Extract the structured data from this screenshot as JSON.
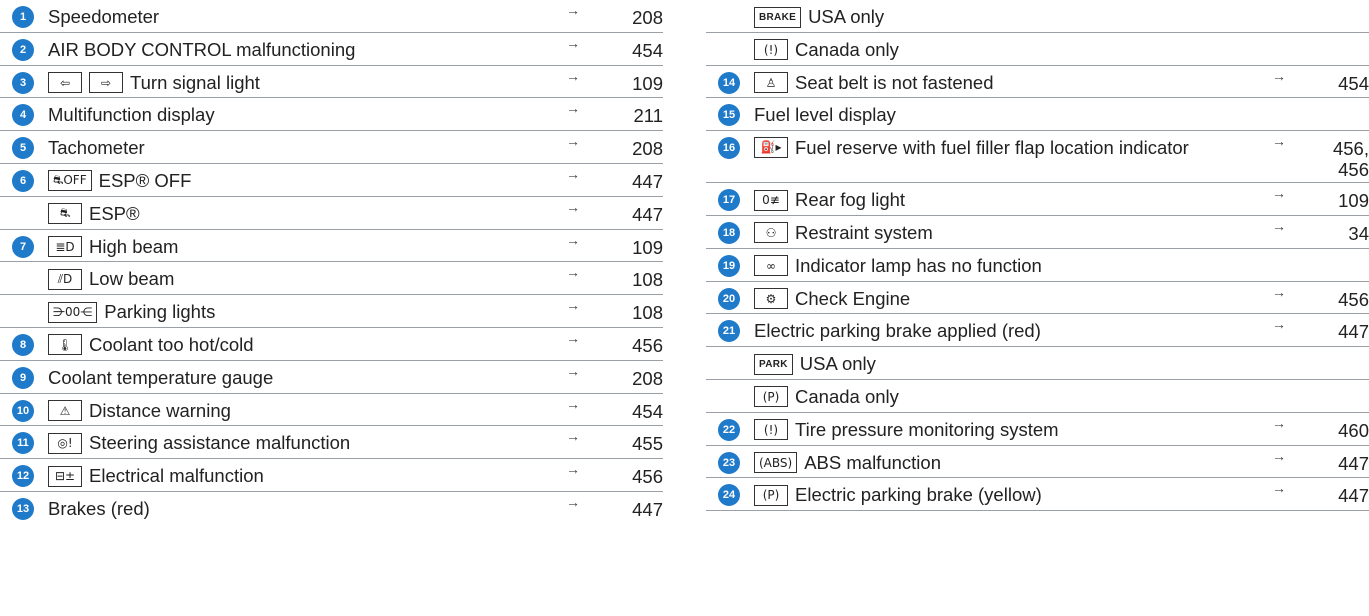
{
  "left_rows": [
    {
      "num": "1",
      "label": "Speedometer",
      "page": "208"
    },
    {
      "num": "2",
      "label": "AIR BODY CONTROL malfunctioning",
      "page": "454"
    },
    {
      "num": "3",
      "symbols": [
        {
          "icon": "turn-left-arrow-icon",
          "glyph": "⇦"
        },
        {
          "icon": "turn-right-arrow-icon",
          "glyph": "⇨"
        }
      ],
      "label": "Turn signal light",
      "page": "109"
    },
    {
      "num": "4",
      "label": "Multifunction display",
      "page": "211"
    },
    {
      "num": "5",
      "label": "Tachometer",
      "page": "208"
    },
    {
      "num": "6",
      "symbols": [
        {
          "icon": "esp-off-icon",
          "glyph": "⛐OFF"
        }
      ],
      "label": "ESP® OFF",
      "page": "447"
    },
    {
      "sub": true,
      "symbols": [
        {
          "icon": "esp-icon",
          "glyph": "⛐"
        }
      ],
      "label": "ESP®",
      "page": "447"
    },
    {
      "num": "7",
      "symbols": [
        {
          "icon": "high-beam-icon",
          "glyph": "≣D"
        }
      ],
      "label": "High beam",
      "page": "109"
    },
    {
      "sub": true,
      "symbols": [
        {
          "icon": "low-beam-icon",
          "glyph": "⫽D"
        }
      ],
      "label": "Low beam",
      "page": "108"
    },
    {
      "sub": true,
      "symbols": [
        {
          "icon": "parking-lights-icon",
          "glyph": "⋺00⋲"
        }
      ],
      "label": "Parking lights",
      "page": "108"
    },
    {
      "num": "8",
      "symbols": [
        {
          "icon": "coolant-icon",
          "glyph": "🌡"
        }
      ],
      "label": "Coolant too hot/cold",
      "page": "456"
    },
    {
      "num": "9",
      "label": "Coolant temperature gauge",
      "page": "208"
    },
    {
      "num": "10",
      "symbols": [
        {
          "icon": "distance-warning-icon",
          "glyph": "⚠"
        }
      ],
      "label": "Distance warning",
      "page": "454"
    },
    {
      "num": "11",
      "symbols": [
        {
          "icon": "steering-assist-icon",
          "glyph": "◎!"
        }
      ],
      "label": "Steering assistance malfunction",
      "page": "455"
    },
    {
      "num": "12",
      "symbols": [
        {
          "icon": "battery-icon",
          "glyph": "⊟±"
        }
      ],
      "label": "Electrical malfunction",
      "page": "456"
    },
    {
      "num": "13",
      "label": "Brakes (red)",
      "page": "447"
    }
  ],
  "right_rows": [
    {
      "sub": true,
      "symbols": [
        {
          "icon": "brake-word-icon",
          "glyph": "BRAKE",
          "word": true
        }
      ],
      "label": "USA only"
    },
    {
      "sub": true,
      "symbols": [
        {
          "icon": "brake-symbol-icon",
          "glyph": "(!)"
        }
      ],
      "label": "Canada only"
    },
    {
      "num": "14",
      "symbols": [
        {
          "icon": "seat-belt-icon",
          "glyph": "♙"
        }
      ],
      "label": "Seat belt is not fastened",
      "page": "454"
    },
    {
      "num": "15",
      "label": "Fuel level display"
    },
    {
      "num": "16",
      "tall": true,
      "symbols": [
        {
          "icon": "fuel-pump-icon",
          "glyph": "⛽▸"
        }
      ],
      "label": "Fuel reserve with fuel filler flap location indicator",
      "page": "456,\n456"
    },
    {
      "num": "17",
      "symbols": [
        {
          "icon": "rear-fog-light-icon",
          "glyph": "0≢"
        }
      ],
      "label": "Rear fog light",
      "page": "109"
    },
    {
      "num": "18",
      "symbols": [
        {
          "icon": "airbag-icon",
          "glyph": "⚇"
        }
      ],
      "label": "Restraint system",
      "page": "34"
    },
    {
      "num": "19",
      "symbols": [
        {
          "icon": "indicator-lamp-icon",
          "glyph": "∞"
        }
      ],
      "label": "Indicator lamp has no function"
    },
    {
      "num": "20",
      "symbols": [
        {
          "icon": "check-engine-icon",
          "glyph": "⚙"
        }
      ],
      "label": "Check Engine",
      "page": "456"
    },
    {
      "num": "21",
      "label": "Electric parking brake applied (red)",
      "page": "447"
    },
    {
      "sub": true,
      "symbols": [
        {
          "icon": "park-word-icon",
          "glyph": "PARK",
          "word": true
        }
      ],
      "label": "USA only"
    },
    {
      "sub": true,
      "symbols": [
        {
          "icon": "parking-brake-symbol-icon",
          "glyph": "(P)"
        }
      ],
      "label": "Canada only"
    },
    {
      "num": "22",
      "symbols": [
        {
          "icon": "tire-pressure-icon",
          "glyph": "(!)"
        }
      ],
      "label": "Tire pressure monitoring system",
      "page": "460"
    },
    {
      "num": "23",
      "symbols": [
        {
          "icon": "abs-icon",
          "glyph": "(ABS)"
        }
      ],
      "label": "ABS malfunction",
      "page": "447"
    },
    {
      "num": "24",
      "symbols": [
        {
          "icon": "parking-brake-yellow-icon",
          "glyph": "(P)"
        }
      ],
      "label": "Electric parking brake (yellow)",
      "page": "447"
    }
  ],
  "arrow_glyph": "→",
  "colors": {
    "badge": "#1f7ac9",
    "rule": "#9aa0a6",
    "text": "#222222"
  }
}
